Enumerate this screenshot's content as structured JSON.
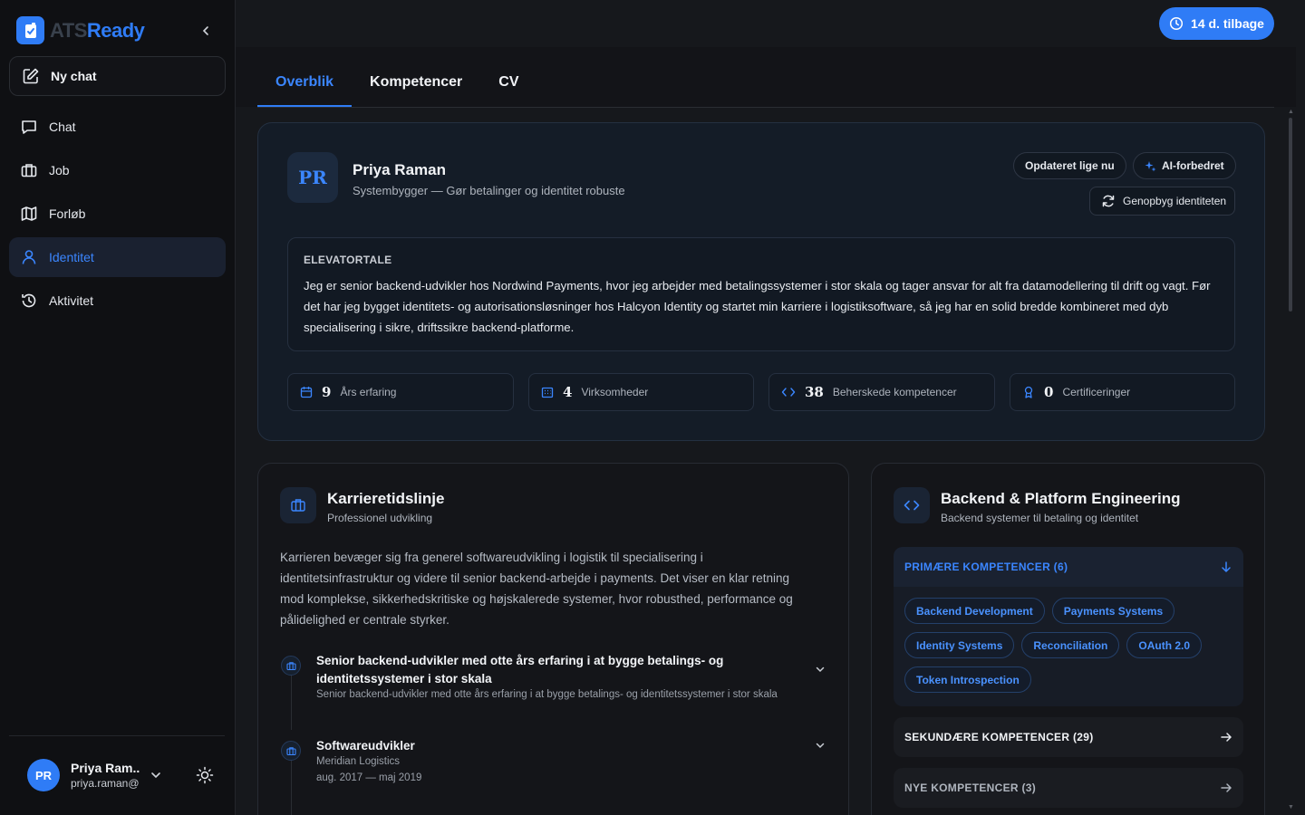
{
  "app": {
    "logo_part1": "ATS",
    "logo_part2": "Ready"
  },
  "sidebar": {
    "new_chat": "Ny chat",
    "items": [
      {
        "label": "Chat",
        "icon": "chat-icon"
      },
      {
        "label": "Job",
        "icon": "briefcase-icon"
      },
      {
        "label": "Forløb",
        "icon": "map-icon"
      },
      {
        "label": "Identitet",
        "icon": "user-icon",
        "active": true
      },
      {
        "label": "Aktivitet",
        "icon": "history-icon"
      }
    ],
    "user": {
      "initials": "PR",
      "name": "Priya Ram...",
      "email": "priya.raman@..."
    }
  },
  "topbar": {
    "trial": "14 d. tilbage"
  },
  "tabs": [
    "Overblik",
    "Kompetencer",
    "CV"
  ],
  "profile": {
    "initials": "PR",
    "name": "Priya Raman",
    "headline": "Systembygger — Gør betalinger og identitet robuste",
    "updated": "Opdateret lige nu",
    "ai": "AI-forbedret",
    "rebuild": "Genopbyg identiteten",
    "elevator_title": "ELEVATORTALE",
    "elevator_text": "Jeg er senior backend-udvikler hos Nordwind Payments, hvor jeg arbejder med betalingssystemer i stor skala og tager ansvar for alt fra datamodellering til drift og vagt. Før det har jeg bygget identitets- og autorisationsløsninger hos Halcyon Identity og startet min karriere i logistiksoftware, så jeg har en solid bredde kombineret med dyb specialisering i sikre, driftssikre backend-platforme.",
    "stats": [
      {
        "value": "9",
        "label": "Års erfaring",
        "icon": "calendar-icon"
      },
      {
        "value": "4",
        "label": "Virksomheder",
        "icon": "building-icon"
      },
      {
        "value": "38",
        "label": "Beherskede kompetencer",
        "icon": "code-icon"
      },
      {
        "value": "0",
        "label": "Certificeringer",
        "icon": "award-icon"
      }
    ]
  },
  "career": {
    "title": "Karrieretidslinje",
    "subtitle": "Professionel udvikling",
    "description": "Karrieren bevæger sig fra generel softwareudvikling i logistik til specialisering i identitetsinfrastruktur og videre til senior backend-arbejde i payments. Det viser en klar retning mod komplekse, sikkerhedskritiske og højskalerede systemer, hvor robusthed, performance og pålidelighed er centrale styrker.",
    "items": [
      {
        "title": "Senior backend-udvikler med otte års erfaring i at bygge betalings- og identitetssystemer i stor skala",
        "sub": "Senior backend-udvikler med otte års erfaring i at bygge betalings- og identitetssystemer i stor skala"
      },
      {
        "title": "Softwareudvikler",
        "company": "Meridian Logistics",
        "dates": "aug. 2017 — maj 2019"
      }
    ]
  },
  "skills": {
    "title": "Backend & Platform Engineering",
    "subtitle": "Backend systemer til betaling og identitet",
    "primary_label": "PRIMÆRE KOMPETENCER (6)",
    "primary": [
      "Backend Development",
      "Payments Systems",
      "Identity Systems",
      "Reconciliation",
      "OAuth 2.0",
      "Token Introspection"
    ],
    "secondary_label": "SEKUNDÆRE KOMPETENCER (29)",
    "new_label": "NYE KOMPETENCER (3)"
  },
  "colors": {
    "accent": "#2f7cf6",
    "background": "#16181c",
    "sidebar": "#0f1013"
  }
}
